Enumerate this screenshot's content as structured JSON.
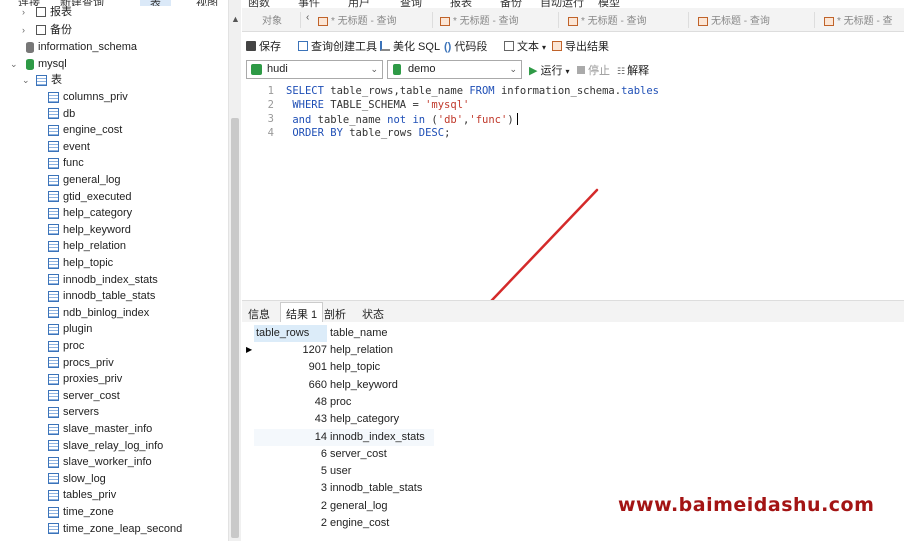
{
  "menu": [
    "连接",
    "新建查询",
    "表",
    "视图",
    "函数",
    "事件",
    "用户",
    "查询",
    "报表",
    "备份",
    "自动运行",
    "模型"
  ],
  "tree": {
    "top_items": [
      {
        "label": "报表",
        "icon": "report-icon"
      },
      {
        "label": "备份",
        "icon": "backup-icon"
      }
    ],
    "schema": "information_schema",
    "database": "mysql",
    "tables_group": "表",
    "tables": [
      "columns_priv",
      "db",
      "engine_cost",
      "event",
      "func",
      "general_log",
      "gtid_executed",
      "help_category",
      "help_keyword",
      "help_relation",
      "help_topic",
      "innodb_index_stats",
      "innodb_table_stats",
      "ndb_binlog_index",
      "plugin",
      "proc",
      "procs_priv",
      "proxies_priv",
      "server_cost",
      "servers",
      "slave_master_info",
      "slave_relay_log_info",
      "slave_worker_info",
      "slow_log",
      "tables_priv",
      "time_zone",
      "time_zone_leap_second"
    ]
  },
  "tabs": {
    "objects": "对象",
    "queries": [
      "* 无标题 - 查询",
      "* 无标题 - 查询",
      "* 无标题 - 查询",
      "无标题 - 查询",
      "* 无标题 - 查"
    ]
  },
  "toolbar": {
    "save": "保存",
    "query_builder": "查询创建工具",
    "beautify": "美化 SQL",
    "code_snippet": "代码段",
    "text": "文本",
    "export": "导出结果"
  },
  "connection": {
    "selected": "hudi",
    "database": "demo"
  },
  "run": {
    "run": "运行",
    "stop": "停止",
    "explain": "解释"
  },
  "editor": {
    "line_numbers": [
      "1",
      "2",
      "3",
      "4"
    ]
  },
  "result_tabs": [
    "信息",
    "结果 1",
    "剖析",
    "状态"
  ],
  "results": {
    "columns": [
      "table_rows",
      "table_name"
    ],
    "rows": [
      {
        "table_rows": "1207",
        "table_name": "help_relation"
      },
      {
        "table_rows": "901",
        "table_name": "help_topic"
      },
      {
        "table_rows": "660",
        "table_name": "help_keyword"
      },
      {
        "table_rows": "48",
        "table_name": "proc"
      },
      {
        "table_rows": "43",
        "table_name": "help_category"
      },
      {
        "table_rows": "14",
        "table_name": "innodb_index_stats"
      },
      {
        "table_rows": "6",
        "table_name": "server_cost"
      },
      {
        "table_rows": "5",
        "table_name": "user"
      },
      {
        "table_rows": "3",
        "table_name": "innodb_table_stats"
      },
      {
        "table_rows": "2",
        "table_name": "general_log"
      },
      {
        "table_rows": "2",
        "table_name": "engine_cost"
      }
    ]
  },
  "watermark": "www.baimeidashu.com",
  "colors": {
    "keyword": "#1f4fb6",
    "string": "#c0392b",
    "arrow": "#d42a2a",
    "watermark": "#a31414",
    "db_icon": "#2e9a46"
  }
}
